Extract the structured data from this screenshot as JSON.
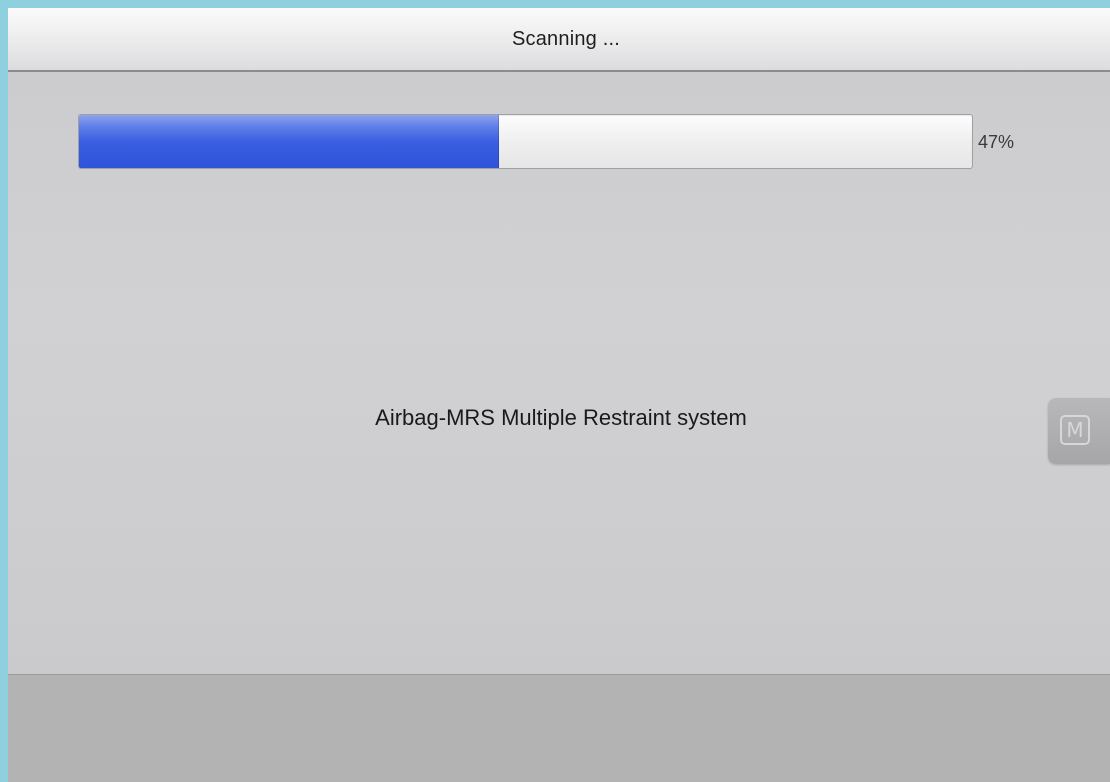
{
  "header": {
    "title": "Scanning ..."
  },
  "progress": {
    "percent_value": 47,
    "percent_label": "47%",
    "fill_color": "#3a5fe0"
  },
  "status": {
    "system_name": "Airbag-MRS Multiple Restraint system"
  },
  "side_button": {
    "icon": "m-icon",
    "label": "M"
  },
  "colors": {
    "frame_border": "#8fd0de",
    "background": "#cfcfd1",
    "footer": "#b3b3b3"
  }
}
